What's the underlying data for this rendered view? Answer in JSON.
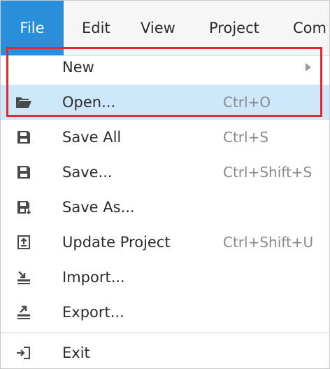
{
  "menubar": {
    "items": [
      {
        "label": "File",
        "active": true
      },
      {
        "label": "Edit"
      },
      {
        "label": "View"
      },
      {
        "label": "Project"
      },
      {
        "label": "Com"
      }
    ],
    "accent_color": "#2a8fdb"
  },
  "file_menu": {
    "items": [
      {
        "label": "New",
        "shortcut": "",
        "icon": "none",
        "has_submenu": true
      },
      {
        "label": "Open...",
        "shortcut": "Ctrl+O",
        "icon": "folder-open-icon",
        "hovered": true
      },
      {
        "label": "Save All",
        "shortcut": "Ctrl+S",
        "icon": "save-all-icon"
      },
      {
        "label": "Save...",
        "shortcut": "Ctrl+Shift+S",
        "icon": "save-icon"
      },
      {
        "label": "Save As...",
        "shortcut": "",
        "icon": "save-as-icon"
      },
      {
        "label": "Update Project",
        "shortcut": "Ctrl+Shift+U",
        "icon": "update-project-icon"
      },
      {
        "label": "Import...",
        "shortcut": "",
        "icon": "import-icon"
      },
      {
        "label": "Export...",
        "shortcut": "",
        "icon": "export-icon"
      },
      {
        "label": "Exit",
        "shortcut": "",
        "icon": "exit-icon"
      }
    ],
    "hover_color": "#cde8fb"
  },
  "annotation": {
    "highlight_color": "#e8262e"
  }
}
